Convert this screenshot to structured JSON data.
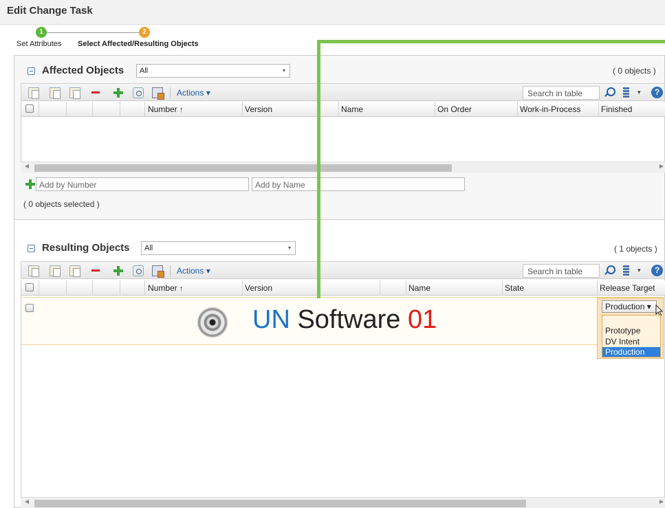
{
  "window": {
    "title": "Edit Change Task"
  },
  "wizard": {
    "steps": [
      {
        "number": "1",
        "label": "Set Attributes",
        "color": "#5cb83a"
      },
      {
        "number": "2",
        "label": "Select Affected/Resulting Objects",
        "color": "#f0a030"
      }
    ]
  },
  "affected": {
    "title": "Affected Objects",
    "filter_value": "All",
    "count": "( 0 objects )",
    "actions_label": "Actions",
    "search_placeholder": "Search in table",
    "columns": [
      "Number",
      "Version",
      "Name",
      "On Order",
      "Work-in-Process",
      "Finished"
    ],
    "add_by_number_placeholder": "Add by Number",
    "add_by_name_placeholder": "Add by Name",
    "selected_status": "( 0 objects selected )"
  },
  "resulting": {
    "title": "Resulting Objects",
    "filter_value": "All",
    "count": "( 1 objects )",
    "actions_label": "Actions",
    "search_placeholder": "Search in table",
    "columns": [
      "Number",
      "Version",
      "Name",
      "State",
      "Release Target"
    ],
    "release_target": {
      "selected": "Production",
      "options": [
        "Prototype",
        "DV Intent",
        "Production"
      ],
      "highlighted": "Production"
    }
  },
  "overlay_logo": {
    "part1": "UN",
    "part2": " Software ",
    "part3": "01"
  },
  "icons": {
    "sort_ascending": "↑",
    "dropdown_arrow": "▾",
    "help": "?"
  },
  "colors": {
    "accent_green": "#7cc44e",
    "selection_blue": "#2f7fdc",
    "logo_blue": "#1a73c8",
    "logo_red": "#e01b1b"
  }
}
